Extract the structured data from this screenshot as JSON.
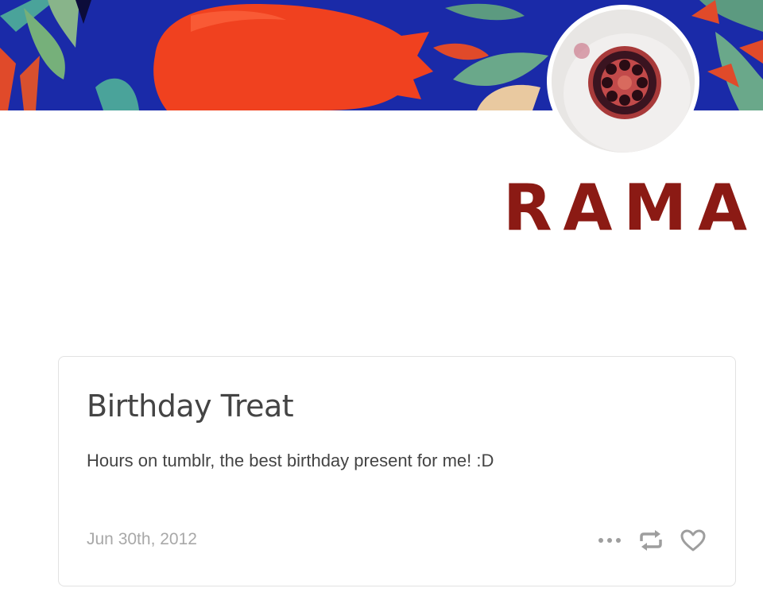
{
  "blog": {
    "title": "RAMA"
  },
  "post": {
    "title": "Birthday Treat",
    "body": "Hours on tumblr, the best birthday present for me! :D",
    "date": "Jun 30th, 2012"
  },
  "actions": {
    "more_icon": "more-dots-icon",
    "reblog_icon": "reblog-icon",
    "like_icon": "heart-icon"
  },
  "colors": {
    "title_accent": "#8b1a14",
    "header_blue": "#1a2aa8",
    "pomegranate_red": "#f0411f",
    "leaf_green": "#5c9a80",
    "text": "#444444",
    "muted": "#a8a8a8",
    "icon": "#9e9e9e"
  }
}
